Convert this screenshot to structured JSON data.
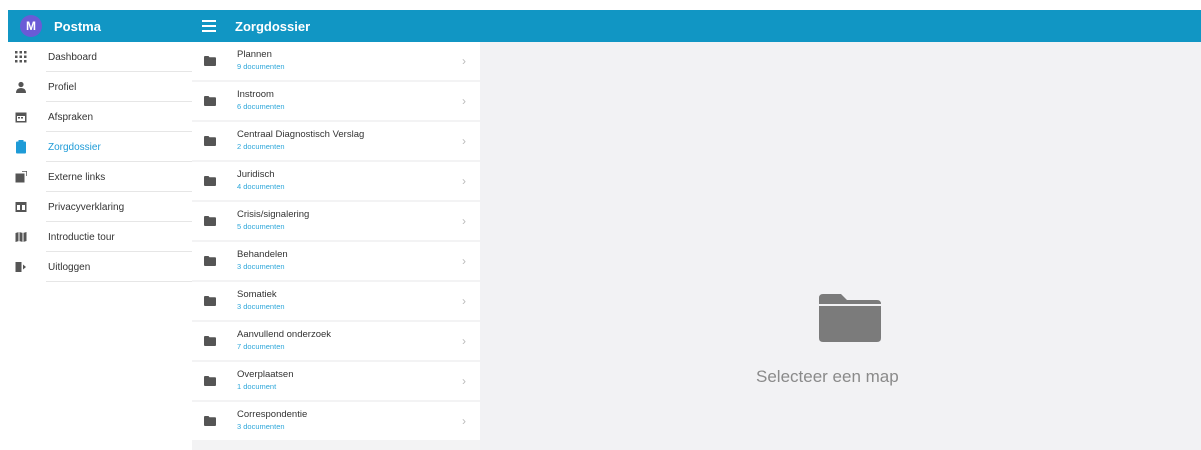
{
  "header": {
    "avatar_letter": "M",
    "user_name": "Postma",
    "section_title": "Zorgdossier",
    "accent_color": "#1196c4"
  },
  "sidebar": {
    "items": [
      {
        "label": "Dashboard",
        "icon": "grid-icon"
      },
      {
        "label": "Profiel",
        "icon": "person-icon"
      },
      {
        "label": "Afspraken",
        "icon": "calendar-icon"
      },
      {
        "label": "Zorgdossier",
        "icon": "clipboard-icon",
        "active": true
      },
      {
        "label": "Externe links",
        "icon": "external-link-icon"
      },
      {
        "label": "Privacyverklaring",
        "icon": "privacy-icon"
      },
      {
        "label": "Introductie tour",
        "icon": "map-icon"
      },
      {
        "label": "Uitloggen",
        "icon": "logout-icon"
      }
    ]
  },
  "folders": [
    {
      "name": "Plannen",
      "count": "9 documenten"
    },
    {
      "name": "Instroom",
      "count": "6 documenten"
    },
    {
      "name": "Centraal Diagnostisch Verslag",
      "count": "2 documenten"
    },
    {
      "name": "Juridisch",
      "count": "4 documenten"
    },
    {
      "name": "Crisis/signalering",
      "count": "5 documenten"
    },
    {
      "name": "Behandelen",
      "count": "3 documenten"
    },
    {
      "name": "Somatiek",
      "count": "3 documenten"
    },
    {
      "name": "Aanvullend onderzoek",
      "count": "7 documenten"
    },
    {
      "name": "Overplaatsen",
      "count": "1 document"
    },
    {
      "name": "Correspondentie",
      "count": "3 documenten"
    }
  ],
  "detail": {
    "empty_message": "Selecteer een map",
    "empty_icon": "folder-icon"
  }
}
